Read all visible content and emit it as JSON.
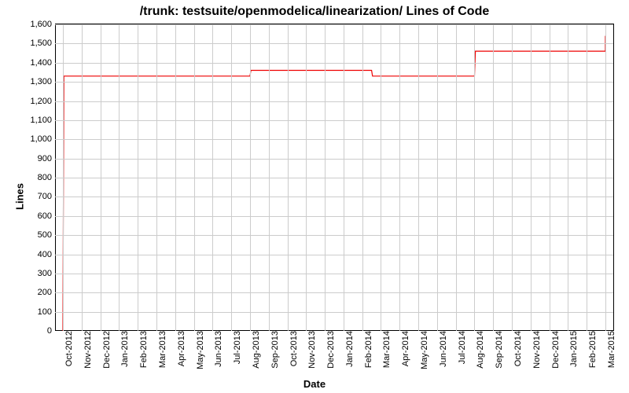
{
  "chart_data": {
    "type": "line",
    "title": "/trunk: testsuite/openmodelica/linearization/ Lines of Code",
    "xlabel": "Date",
    "ylabel": "Lines",
    "ylim": [
      0,
      1600
    ],
    "yticks": [
      0,
      100,
      200,
      300,
      400,
      500,
      600,
      700,
      800,
      900,
      1000,
      1100,
      1200,
      1300,
      1400,
      1500,
      1600
    ],
    "ytick_labels": [
      "0",
      "100",
      "200",
      "300",
      "400",
      "500",
      "600",
      "700",
      "800",
      "900",
      "1,000",
      "1,100",
      "1,200",
      "1,300",
      "1,400",
      "1,500",
      "1,600"
    ],
    "x_categories": [
      "Oct-2012",
      "Nov-2012",
      "Dec-2012",
      "Jan-2013",
      "Feb-2013",
      "Mar-2013",
      "Apr-2013",
      "May-2013",
      "Jun-2013",
      "Jul-2013",
      "Aug-2013",
      "Sep-2013",
      "Oct-2013",
      "Nov-2013",
      "Dec-2013",
      "Jan-2014",
      "Feb-2014",
      "Mar-2014",
      "Apr-2014",
      "May-2014",
      "Jun-2014",
      "Jul-2014",
      "Aug-2014",
      "Sep-2014",
      "Oct-2014",
      "Nov-2014",
      "Dec-2014",
      "Jan-2015",
      "Feb-2015",
      "Mar-2015"
    ],
    "series": [
      {
        "name": "Lines of Code",
        "color": "#e00",
        "points": [
          {
            "x_index": 0.0,
            "y": 0
          },
          {
            "x_index": 0.05,
            "y": 1330
          },
          {
            "x_index": 10.0,
            "y": 1330
          },
          {
            "x_index": 10.05,
            "y": 1360
          },
          {
            "x_index": 16.5,
            "y": 1360
          },
          {
            "x_index": 16.55,
            "y": 1330
          },
          {
            "x_index": 22.0,
            "y": 1330
          },
          {
            "x_index": 22.05,
            "y": 1460
          },
          {
            "x_index": 29.0,
            "y": 1460
          },
          {
            "x_index": 29.0,
            "y": 1540
          }
        ]
      }
    ]
  }
}
